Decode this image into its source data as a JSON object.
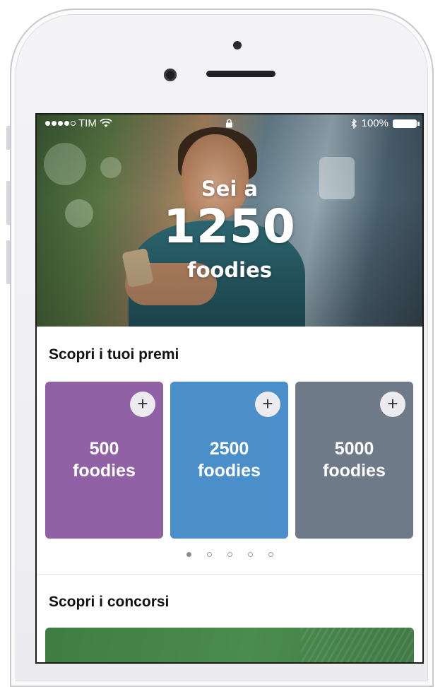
{
  "status_bar": {
    "carrier": "TIM",
    "battery": "100%"
  },
  "hero": {
    "line1": "Sei a",
    "points": "1250",
    "line3": "foodies"
  },
  "rewards": {
    "title": "Scopri i tuoi premi",
    "cards": [
      {
        "amount": "500",
        "unit": "foodies",
        "color": "#9161a6"
      },
      {
        "amount": "2500",
        "unit": "foodies",
        "color": "#4a8fc9"
      },
      {
        "amount": "5000",
        "unit": "foodies",
        "color": "#6f7a88"
      }
    ],
    "add_symbol": "+",
    "pager": {
      "count": 5,
      "active_index": 0
    }
  },
  "contests": {
    "title": "Scopri i concorsi"
  }
}
